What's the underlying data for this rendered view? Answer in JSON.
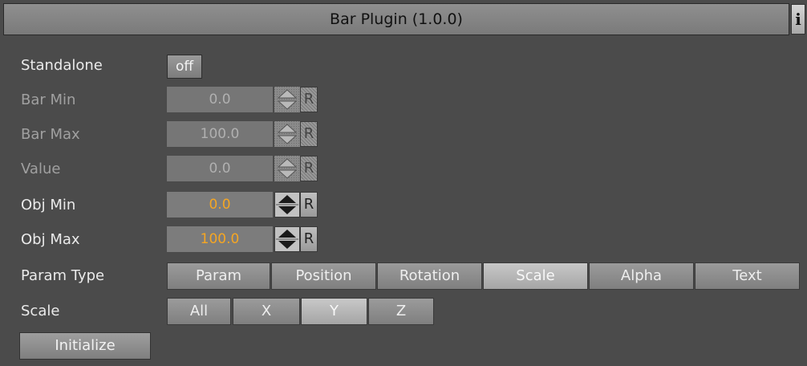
{
  "title": "Bar Plugin (1.0.0)",
  "info_label": "i",
  "standalone": {
    "label": "Standalone",
    "value": "off"
  },
  "fields": [
    {
      "label": "Bar Min",
      "value": "0.0",
      "enabled": false
    },
    {
      "label": "Bar Max",
      "value": "100.0",
      "enabled": false
    },
    {
      "label": "Value",
      "value": "0.0",
      "enabled": false
    },
    {
      "label": "Obj Min",
      "value": "0.0",
      "enabled": true
    },
    {
      "label": "Obj Max",
      "value": "100.0",
      "enabled": true
    }
  ],
  "reset_label": "R",
  "param_type": {
    "label": "Param Type",
    "options": [
      "Param",
      "Position",
      "Rotation",
      "Scale",
      "Alpha",
      "Text"
    ],
    "selected": "Scale"
  },
  "scale": {
    "label": "Scale",
    "options": [
      "All",
      "X",
      "Y",
      "Z"
    ],
    "selected": "Y"
  },
  "initialize_label": "Initialize",
  "colors": {
    "background": "#4b4b4b",
    "active_value": "#f5a623",
    "dim_text": "#a0a0a0"
  }
}
